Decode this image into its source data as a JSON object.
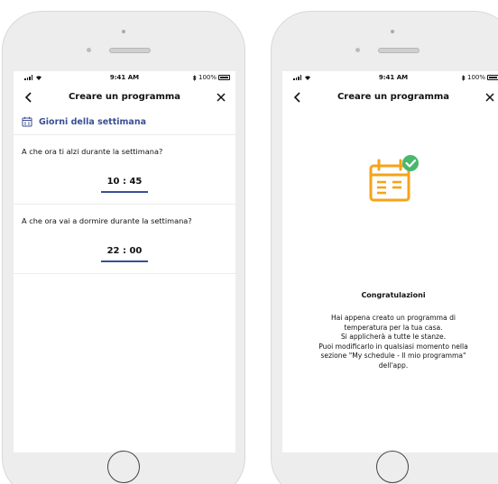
{
  "status_bar": {
    "time": "9:41 AM",
    "battery": "100%",
    "battery_level": 1.0
  },
  "screen_left": {
    "title": "Creare un programma",
    "section_label": "Giorni della settimana",
    "questions": [
      {
        "text": "A che ora ti alzi durante la settimana?",
        "time": "10 : 45"
      },
      {
        "text": "A che ora vai a dormire durante la settimana?",
        "time": "22 : 00"
      }
    ]
  },
  "screen_right": {
    "title": "Creare un programma",
    "congrats_title": "Congratulazioni",
    "message_lines": [
      "Hai appena creato un programma di",
      "temperatura per la tua casa.",
      "Si applicherà a tutte le stanze.",
      "Puoi modificarlo in qualsiasi momento nella",
      "sezione \"My schedule - Il mio programma\"",
      "dell'app."
    ]
  },
  "colors": {
    "accent": "#3a4f95",
    "calendar_orange": "#f5a31a",
    "check_green": "#49b76e"
  }
}
